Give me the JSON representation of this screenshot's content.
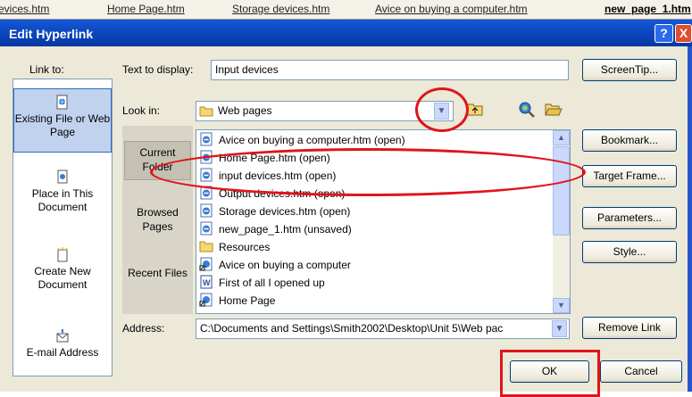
{
  "tabstrip": {
    "tabs": [
      {
        "label": "evices.htm"
      },
      {
        "label": "Home Page.htm"
      },
      {
        "label": "Storage devices.htm"
      },
      {
        "label": "Avice on buying a computer.htm"
      },
      {
        "label": "new_page_1.htm"
      }
    ]
  },
  "dialog": {
    "title": "Edit Hyperlink",
    "help_glyph": "?",
    "close_glyph": "X"
  },
  "link_to": {
    "label": "Link to:",
    "items": [
      {
        "label": "Existing File or Web Page",
        "icon": "existing-file-icon",
        "selected": true
      },
      {
        "label": "Place in This Document",
        "icon": "place-in-document-icon"
      },
      {
        "label": "Create New Document",
        "icon": "create-new-document-icon"
      },
      {
        "label": "E-mail Address",
        "icon": "email-address-icon"
      }
    ]
  },
  "text_display": {
    "label": "Text to display:",
    "value": "Input devices"
  },
  "look_in": {
    "label": "Look in:",
    "value": "Web pages"
  },
  "places": [
    {
      "label": "Current Folder",
      "selected": true
    },
    {
      "label": "Browsed Pages"
    },
    {
      "label": "Recent Files"
    }
  ],
  "files": [
    {
      "name": "Avice on buying a computer.htm (open)",
      "icon": "ie-page-icon"
    },
    {
      "name": "Home Page.htm (open)",
      "icon": "ie-page-icon"
    },
    {
      "name": "input devices.htm (open)",
      "icon": "ie-page-icon"
    },
    {
      "name": "Output devices.htm (open)",
      "icon": "ie-page-icon"
    },
    {
      "name": "Storage devices.htm (open)",
      "icon": "ie-page-icon"
    },
    {
      "name": "new_page_1.htm (unsaved)",
      "icon": "ie-page-icon"
    },
    {
      "name": "Resources",
      "icon": "folder-icon"
    },
    {
      "name": "Avice on buying a computer",
      "icon": "shortcut-icon"
    },
    {
      "name": "First of all I opened up",
      "icon": "word-doc-icon"
    },
    {
      "name": "Home Page",
      "icon": "shortcut-icon"
    }
  ],
  "address": {
    "label": "Address:",
    "value": "C:\\Documents and Settings\\Smith2002\\Desktop\\Unit 5\\Web pac"
  },
  "buttons": {
    "screentip": "ScreenTip...",
    "bookmark": "Bookmark...",
    "target_frame": "Target Frame...",
    "parameters": "Parameters...",
    "style": "Style...",
    "remove_link": "Remove Link",
    "ok": "OK",
    "cancel": "Cancel"
  },
  "colors": {
    "annotation": "#e0141a",
    "titlebar": "#0a43b8",
    "selection": "#c1d2ee"
  }
}
